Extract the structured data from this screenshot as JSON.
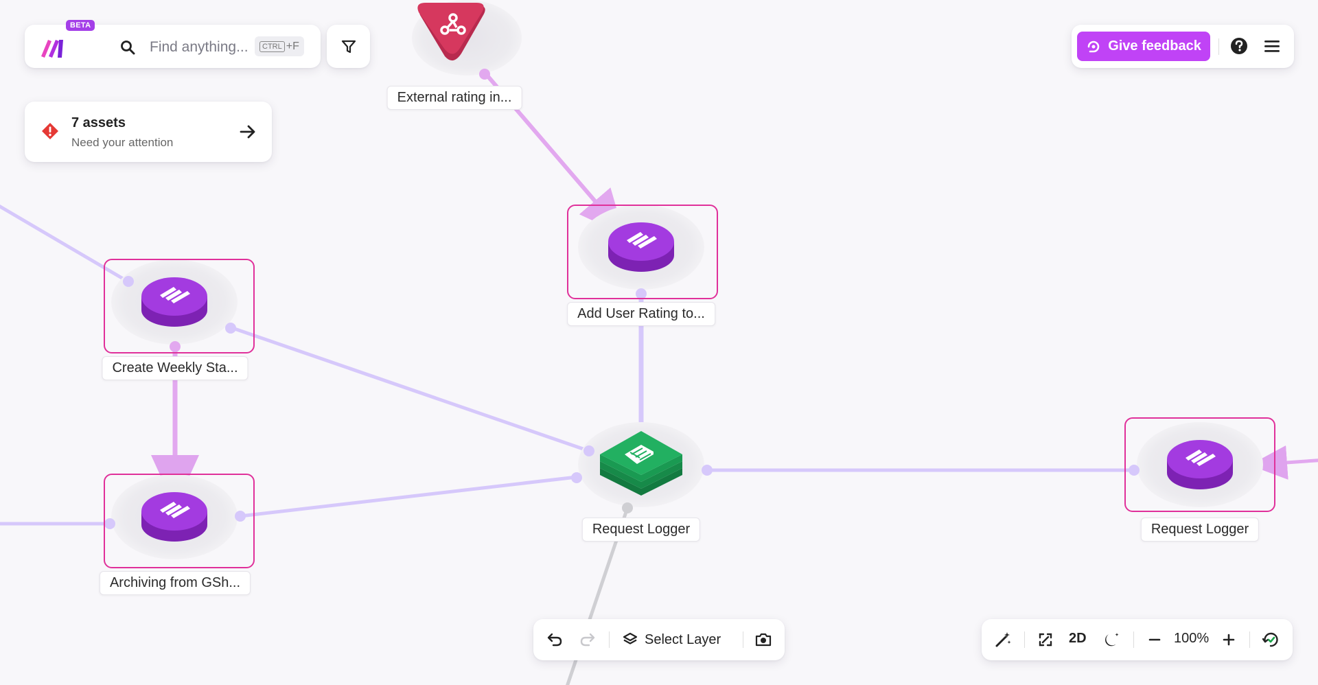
{
  "app": {
    "beta_badge": "BETA",
    "brand_color": "#c043f6"
  },
  "search": {
    "placeholder": "Find anything...",
    "shortcut_key": "CTRL",
    "shortcut_suffix": "+F"
  },
  "alert": {
    "title": "7 assets",
    "subtitle": "Need your attention"
  },
  "header": {
    "feedback_label": "Give feedback"
  },
  "nodes": [
    {
      "label": "External rating in...",
      "type": "webhook",
      "color": "#d6385e"
    },
    {
      "label": "Add User Rating to...",
      "type": "make-scenario",
      "color": "#9b2fd1"
    },
    {
      "label": "Create Weekly Sta...",
      "type": "make-scenario",
      "color": "#9b2fd1"
    },
    {
      "label": "Archiving from GSh...",
      "type": "make-scenario",
      "color": "#9b2fd1"
    },
    {
      "label": "Request Logger",
      "type": "google-sheets",
      "color": "#1f9d55"
    },
    {
      "label": "Request Logger",
      "type": "make-scenario",
      "color": "#9b2fd1"
    }
  ],
  "toolbar": {
    "select_layer_label": "Select Layer"
  },
  "view": {
    "mode_label": "2D",
    "zoom": "100%"
  },
  "colors": {
    "edge": "#d6c8fb",
    "edge_pink": "#e2a8ef",
    "selection": "#e0309a",
    "edge_gray": "#cfcfd3"
  }
}
